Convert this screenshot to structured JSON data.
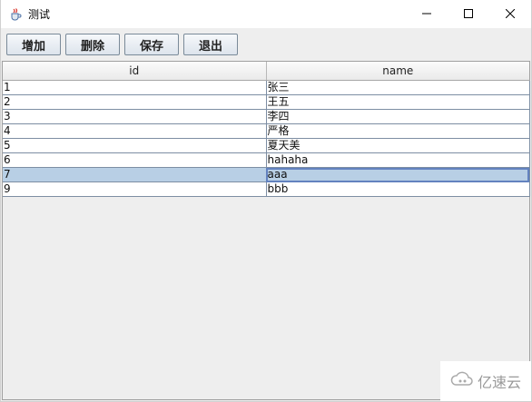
{
  "window": {
    "title": "测试",
    "icon": "java-cup-icon"
  },
  "controls": {
    "minimize": "minimize-icon",
    "maximize": "maximize-icon",
    "close": "close-icon"
  },
  "toolbar": {
    "add_label": "增加",
    "delete_label": "删除",
    "save_label": "保存",
    "exit_label": "退出"
  },
  "table": {
    "columns": [
      "id",
      "name"
    ],
    "rows": [
      {
        "id": "1",
        "name": "张三"
      },
      {
        "id": "2",
        "name": "王五"
      },
      {
        "id": "3",
        "name": "李四"
      },
      {
        "id": "4",
        "name": "严格"
      },
      {
        "id": "5",
        "name": "夏天美"
      },
      {
        "id": "6",
        "name": "hahaha"
      },
      {
        "id": "7",
        "name": "aaa"
      },
      {
        "id": "9",
        "name": "bbb"
      }
    ],
    "selected_row": 6
  },
  "watermark": {
    "text": "亿速云"
  },
  "colors": {
    "selection": "#b8cfe5",
    "focus_border": "#6382bf"
  }
}
